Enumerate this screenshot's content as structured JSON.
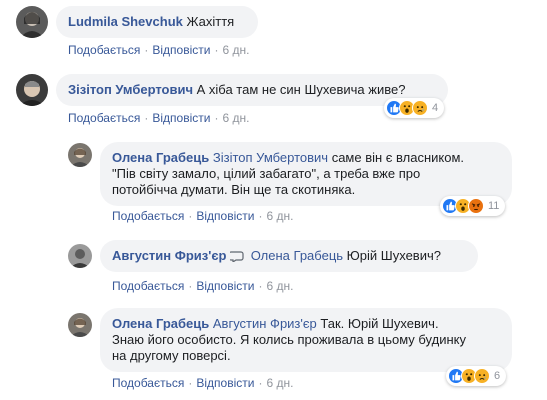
{
  "actions": {
    "like": "Подобається",
    "reply": "Відповісти",
    "separator": "·"
  },
  "comments": [
    {
      "author": "Ludmila Shevchuk",
      "text": "Жахіття",
      "time": "6 дн."
    },
    {
      "author": "Зізітоп Умбертович",
      "text": "А хіба там не син Шухевича живе?",
      "time": "6 дн.",
      "reactions": {
        "icons": [
          "like-icon",
          "wow-icon",
          "sad-icon"
        ],
        "count": "4"
      }
    },
    {
      "author": "Олена Грабець",
      "mention": "Зізітоп Умбертович",
      "text_line1": "саме він є власником.",
      "text_line2": "\"Пів світу замало, цілий забагато\", а треба вже про",
      "text_line3": "потойбічча думати. Він ще та скотиняка.",
      "time": "6 дн.",
      "reactions": {
        "icons": [
          "like-icon",
          "wow-icon",
          "angry-icon"
        ],
        "count": "11"
      }
    },
    {
      "author": "Августин Фриз'єр",
      "mention": "Олена Грабець",
      "text": "Юрій Шухевич?",
      "time": "6 дн."
    },
    {
      "author": "Олена Грабець",
      "mention": "Августин Фриз'єр",
      "text_line1": "Так. Юрій Шухевич.",
      "text_line2": "Знаю його особисто. Я колись проживала в цьому будинку",
      "text_line3": "на другому поверсі.",
      "time": "6 дн.",
      "reactions": {
        "icons": [
          "like-icon",
          "wow-icon",
          "sad-icon"
        ],
        "count": "6"
      }
    }
  ],
  "colors": {
    "link": "#385898",
    "bubble": "#f2f3f5",
    "meta": "#90949c",
    "like": "#2078f4",
    "wow": "#f7b125",
    "angry": "#e9710f"
  }
}
